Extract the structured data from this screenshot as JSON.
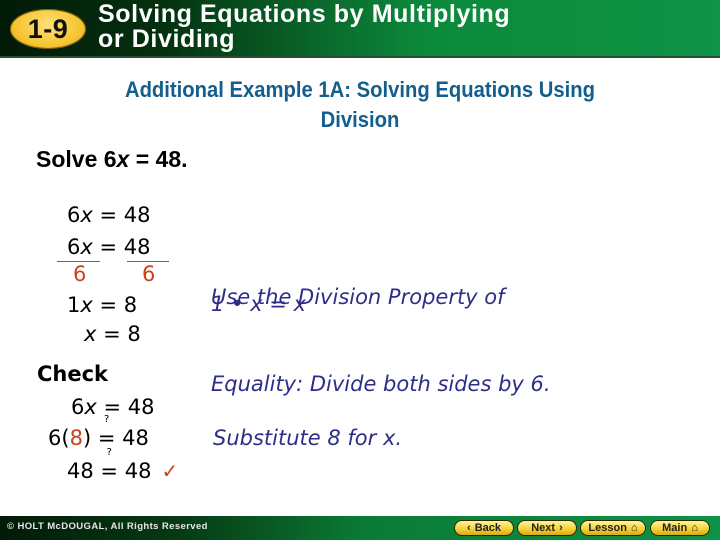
{
  "header": {
    "lesson_badge": "1-9",
    "title_line1": "Solving Equations by Multiplying",
    "title_line2": "or Dividing"
  },
  "subtitle_line1": "Additional Example 1A: Solving Equations Using",
  "subtitle_line2": "Division",
  "problem": {
    "prefix": "Solve 6",
    "variable": "x",
    "suffix": " = 48."
  },
  "solution": {
    "step1": {
      "lhs_coef": "6",
      "var": "x",
      "eq": "=",
      "rhs": "48"
    },
    "step2": {
      "lhs_coef": "6",
      "var": "x",
      "eq": "=",
      "rhs": "48",
      "divisor_left": "6",
      "divisor_right": "6"
    },
    "step3": {
      "lhs_coef": "1",
      "var": "x",
      "eq": "=",
      "rhs": "8"
    },
    "step4": {
      "var": "x",
      "eq": "=",
      "rhs": "8"
    }
  },
  "notes": {
    "division_line1": "Use the Division Property of",
    "division_line2": "Equality: Divide both sides by 6.",
    "identity": "1 • x = x",
    "substitute": "Substitute 8 for x."
  },
  "check": {
    "label": "Check",
    "line1": {
      "lhs_coef": "6",
      "var": "x",
      "eq": "=",
      "rhs": "48"
    },
    "line2": {
      "lhs_open": "6(",
      "value": "8",
      "lhs_close": ")",
      "eq": "=",
      "question": "?",
      "rhs": "48"
    },
    "line3": {
      "lhs": "48",
      "eq": "=",
      "question": "?",
      "rhs": "48",
      "checkmark": "✓"
    }
  },
  "footer": {
    "copyright": "© HOLT McDOUGAL, All Rights Reserved",
    "buttons": [
      {
        "label": "Back",
        "icon": "‹"
      },
      {
        "label": "Next",
        "icon": "›"
      },
      {
        "label": "Lesson",
        "icon": "⌂"
      },
      {
        "label": "Main",
        "icon": "⌂"
      }
    ]
  }
}
